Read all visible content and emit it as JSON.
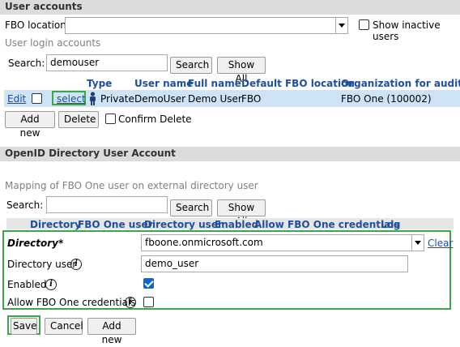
{
  "user_accounts": {
    "title": "User accounts",
    "fbo_location_label": "FBO location:",
    "fbo_location_value": "",
    "show_inactive_label": "Show inactive users",
    "login_accounts_label": "User login accounts",
    "search_label": "Search:",
    "search_value": "demouser",
    "search_button": "Search",
    "show_all_button": "Show All",
    "columns": [
      "Type",
      "User name",
      "Full name",
      "Default FBO location",
      "Organization for audit log"
    ],
    "row": {
      "edit": "Edit",
      "select": "select",
      "type": "Private",
      "user_name": "DemoUser",
      "full_name": "Demo User",
      "default_fbo_location": "FBO",
      "organization": "FBO One (100002)"
    },
    "add_new_button": "Add new",
    "delete_button": "Delete",
    "confirm_delete_label": "Confirm Delete"
  },
  "openid": {
    "title": "OpenID Directory User Account",
    "mapping_label": "Mapping of FBO One user on external directory user",
    "search_label": "Search:",
    "search_value": "",
    "search_button": "Search",
    "show_all_button": "Show All",
    "columns": [
      "Directory",
      "FBO One user",
      "Directory user",
      "Enabled",
      "Allow FBO One credentials",
      "Log"
    ],
    "form": {
      "directory_label": "Directory*",
      "directory_value": "fboone.onmicrosoft.com",
      "clear_link": "Clear",
      "directory_user_label": "Directory user",
      "directory_user_value": "demo_user",
      "enabled_label": "Enabled",
      "enabled_checked": true,
      "allow_credentials_label": "Allow FBO One credentials",
      "allow_credentials_checked": false
    },
    "save_button": "Save",
    "cancel_button": "Cancel",
    "add_new_button": "Add new"
  },
  "colors": {
    "highlight_green": "#3aa84a",
    "header_gray": "#dcdcdc",
    "column_blue": "#1f4fa0",
    "row_selected": "#cfe3f6",
    "checkbox_blue": "#0a66d6"
  },
  "icons": [
    "dropdown-arrow-icon",
    "user-icon",
    "info-icon"
  ]
}
